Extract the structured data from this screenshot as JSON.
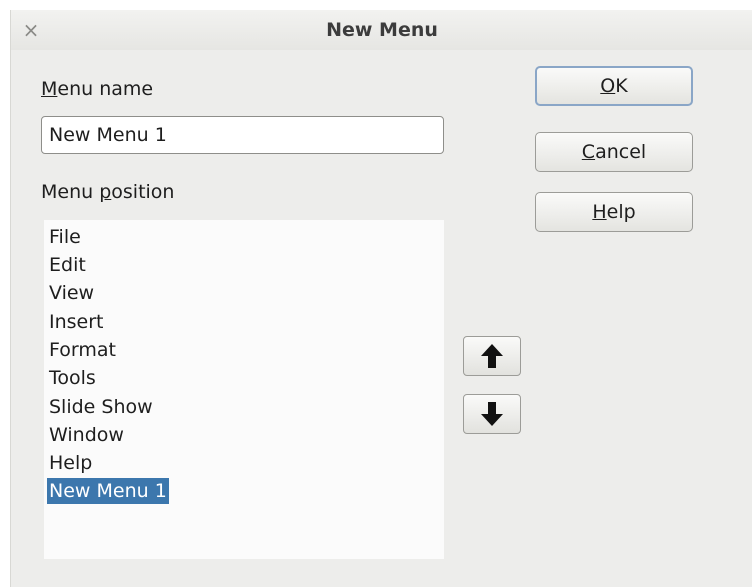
{
  "window": {
    "title": "New Menu",
    "close_glyph": "×"
  },
  "menu_name": {
    "label_underlined": "M",
    "label_rest": "enu name",
    "value": "New Menu 1"
  },
  "menu_position": {
    "label_before": "Menu ",
    "label_underlined": "p",
    "label_after": "osition",
    "items": [
      "File",
      "Edit",
      "View",
      "Insert",
      "Format",
      "Tools",
      "Slide Show",
      "Window",
      "Help",
      "New Menu 1"
    ],
    "selected_index": 9
  },
  "buttons": {
    "ok": {
      "underlined": "O",
      "rest": "K"
    },
    "cancel": {
      "underlined": "C",
      "rest": "ancel"
    },
    "help": {
      "underlined": "H",
      "rest": "elp"
    }
  },
  "icons": {
    "move_up": "arrow-up-icon",
    "move_down": "arrow-down-icon"
  },
  "colors": {
    "selection_bg": "#3c77ad",
    "dialog_bg": "#ededeb"
  }
}
